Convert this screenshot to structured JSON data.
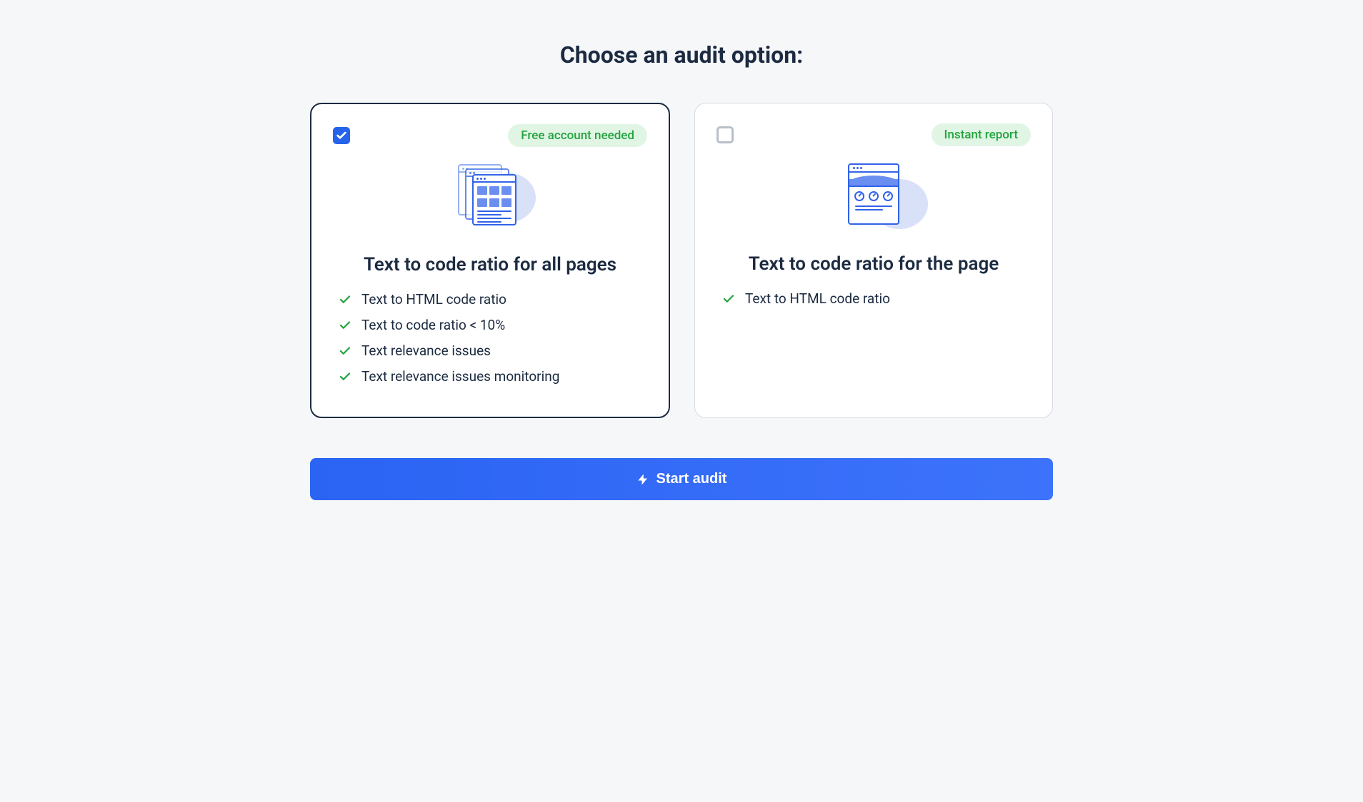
{
  "page": {
    "title": "Choose an audit option:"
  },
  "options": [
    {
      "selected": true,
      "badge": "Free account needed",
      "title": "Text to code ratio for all pages",
      "features": [
        "Text to HTML code ratio",
        "Text to code ratio < 10%",
        "Text relevance issues",
        "Text relevance issues monitoring"
      ]
    },
    {
      "selected": false,
      "badge": "Instant report",
      "title": "Text to code ratio for the page",
      "features": [
        "Text to HTML code ratio"
      ]
    }
  ],
  "cta": {
    "label": "Start audit"
  }
}
